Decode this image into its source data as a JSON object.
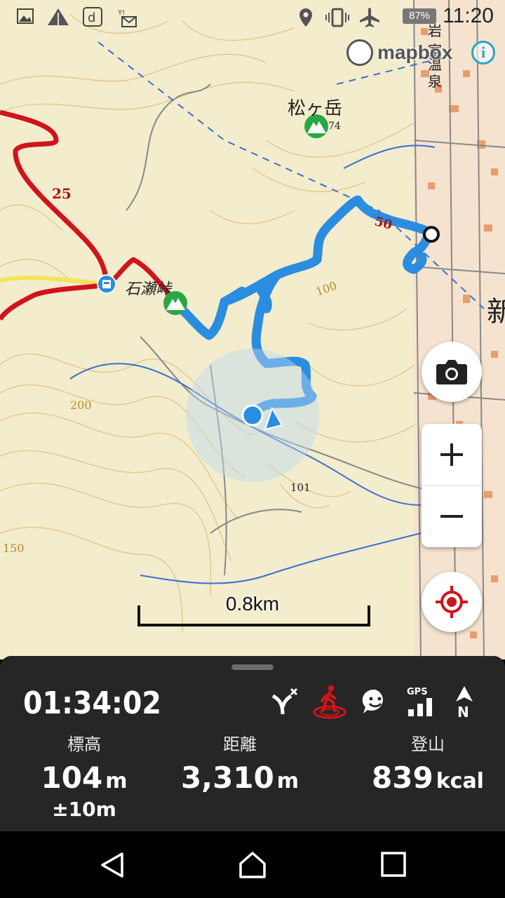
{
  "status_bar": {
    "battery": "87%",
    "time": "11:20",
    "icons": [
      "image-icon",
      "signal-triangle-icon",
      "docomo-d-icon",
      "yahoo-mail-icon",
      "location-pin-icon",
      "vibrate-icon",
      "airplane-icon"
    ]
  },
  "map": {
    "attribution": "mapbox",
    "info_label": "i",
    "place_labels": {
      "peak_matsugatake": "松ヶ岳",
      "pass_ishigami": "石瀬峠",
      "temple_iwaya": "岩",
      "temple_iwaya2": "室",
      "onsen1": "温",
      "onsen2": "泉",
      "elev_74": "74",
      "elev_101": "101",
      "contour_100": "100",
      "contour_200": "200",
      "contour_150": "150",
      "route_25": "25",
      "route_50": "50",
      "shin": "新"
    },
    "scale_label": "0.8km"
  },
  "controls": {
    "camera": "camera-icon",
    "zoom_in": "+",
    "zoom_out": "−",
    "locate": "crosshair-icon"
  },
  "panel": {
    "timer": "01:34:02",
    "icons": [
      "route-off-icon",
      "hiker-icon",
      "face-chat-icon",
      "gps-signal-icon",
      "north-arrow-icon"
    ],
    "gps_label": "GPS",
    "north_label": "N",
    "elevation": {
      "label": "標高",
      "value": "104",
      "unit": "m",
      "accuracy": "±10m"
    },
    "distance": {
      "label": "距離",
      "value": "3,310",
      "unit": "m"
    },
    "calories": {
      "label": "登山",
      "value": "839",
      "unit": "kcal"
    }
  },
  "colors": {
    "route": "#2b8de0",
    "road": "#d0141c",
    "accent_red": "#d0141c",
    "panel_bg": "#262626",
    "peak_green": "#2aa745"
  }
}
